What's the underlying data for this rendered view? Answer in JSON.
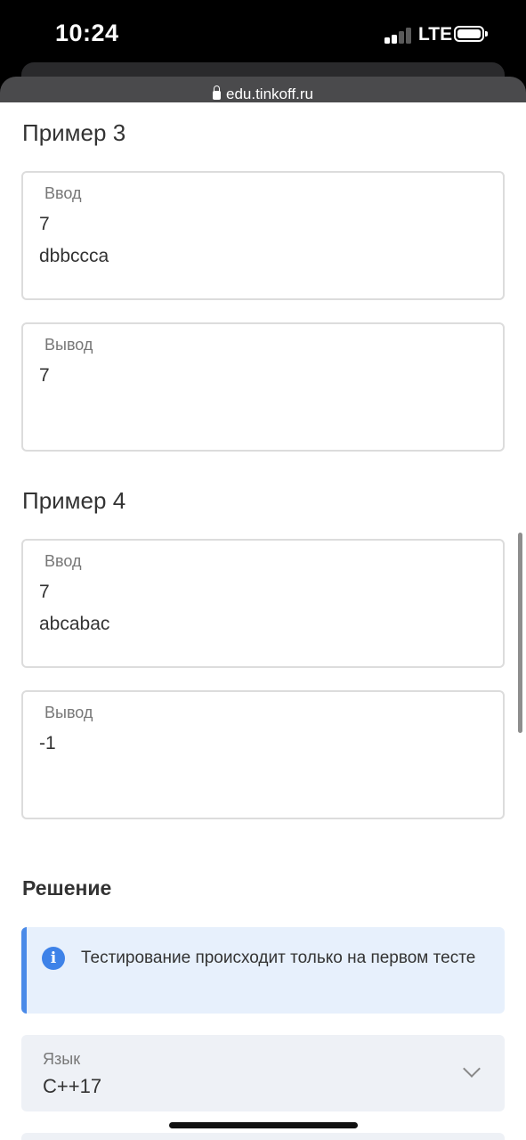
{
  "status_bar": {
    "time": "10:24",
    "network": "LTE"
  },
  "browser": {
    "url": "edu.tinkoff.ru"
  },
  "examples": [
    {
      "title": "Пример 3",
      "input_label": "Ввод",
      "input_value": "7\ndbbccca",
      "output_label": "Вывод",
      "output_value": "7"
    },
    {
      "title": "Пример 4",
      "input_label": "Ввод",
      "input_value": "7\nabcabac",
      "output_label": "Вывод",
      "output_value": "-1"
    }
  ],
  "solution": {
    "title": "Решение",
    "info_text": "Тестирование происходит только на первом тесте",
    "language_label": "Язык",
    "language_value": "C++17"
  },
  "colors": {
    "info_accent": "#4a8ae8",
    "info_background": "#e7f0fc",
    "select_background": "#eef1f6"
  }
}
